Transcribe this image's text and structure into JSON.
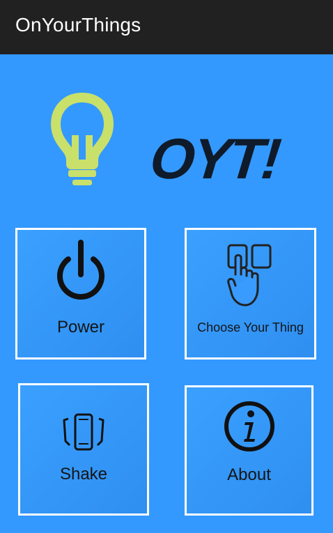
{
  "app_bar": {
    "title": "OnYourThings"
  },
  "logo": {
    "icon": "lightbulb-icon",
    "text": "OYT!",
    "bulb_color": "#c9e06a"
  },
  "tiles": [
    {
      "label": "Power",
      "icon": "power-icon"
    },
    {
      "label": "Choose Your Thing",
      "icon": "tap-select-icon"
    },
    {
      "label": "Shake",
      "icon": "shake-phone-icon"
    },
    {
      "label": "About",
      "icon": "info-icon"
    }
  ],
  "colors": {
    "action_bar": "#212121",
    "background": "#3399ff",
    "tile_border": "#ffffff",
    "logo_text": "#0f1b2a"
  }
}
